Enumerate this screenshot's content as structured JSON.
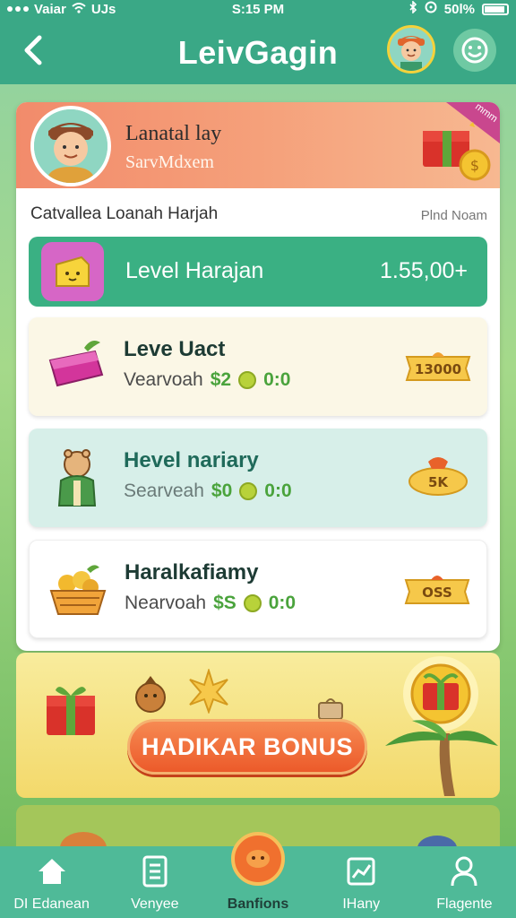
{
  "status_bar": {
    "carrier": "Vaiar",
    "network": "UJs",
    "time": "S:15 PM",
    "battery": "50l%"
  },
  "header": {
    "title": "LeivGagin"
  },
  "profile": {
    "name": "Lanatal lay",
    "subtitle": "SarvMdxem",
    "ribbon": "mmm"
  },
  "list_header": {
    "left": "Catvallea Loanah Harjah",
    "right": "Plnd Noam"
  },
  "level": {
    "label": "Level Harajan",
    "value": "1.55,00+"
  },
  "items": [
    {
      "title": "Leve Uact",
      "meta_label": "Vearvoah",
      "amount": "$2",
      "value": "0:0",
      "badge": "13000",
      "bg": "#fbf7e6",
      "icon": "purse-icon"
    },
    {
      "title": "Hevel nariary",
      "meta_label": "Searveah",
      "amount": "$0",
      "value": "0:0",
      "badge": "5K",
      "bg": "#d7efe9",
      "icon": "bear-figure-icon"
    },
    {
      "title": "Haralkafiamy",
      "meta_label": "Nearvoah",
      "amount": "$S",
      "value": "0:0",
      "badge": "OSS",
      "bg": "#ffffff",
      "icon": "fruit-basket-icon"
    }
  ],
  "bonus": {
    "button": "HADIKAR BONUS"
  },
  "bottom_nav": [
    {
      "label": "DI Edanean",
      "icon": "home-icon",
      "active": false
    },
    {
      "label": "Venyee",
      "icon": "list-icon",
      "active": false
    },
    {
      "label": "Banfions",
      "icon": "center-coin-icon",
      "active": true
    },
    {
      "label": "IHany",
      "icon": "chart-icon",
      "active": false
    },
    {
      "label": "Flagente",
      "icon": "profile-icon",
      "active": false
    }
  ],
  "colors": {
    "primary": "#3aa886",
    "accent": "#f0702e",
    "gold": "#f6c84a",
    "banner": "#f28b6b"
  }
}
